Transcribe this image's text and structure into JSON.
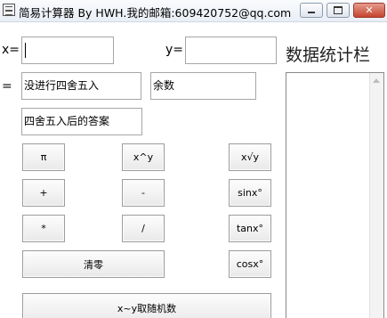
{
  "window": {
    "title": "简易计算器 By HWH.我的邮箱:609420752@qq.com",
    "close_label": "✕"
  },
  "inputs": {
    "x_label": "x=",
    "x_value": "",
    "y_label": "y=",
    "y_value": ""
  },
  "results": {
    "equals_label": "=",
    "result_value": "没进行四舍五入",
    "remainder_value": "余数",
    "rounded_value": "四舍五入后的答案"
  },
  "buttons": {
    "pi": "π",
    "power": "x^y",
    "root": "x√y",
    "add": "+",
    "subtract": "-",
    "sin": "sinx°",
    "multiply": "*",
    "divide": "/",
    "tan": "tanx°",
    "clear": "清零",
    "cos": "cosx°",
    "random": "x~y取随机数"
  },
  "stats": {
    "title": "数据统计栏"
  }
}
